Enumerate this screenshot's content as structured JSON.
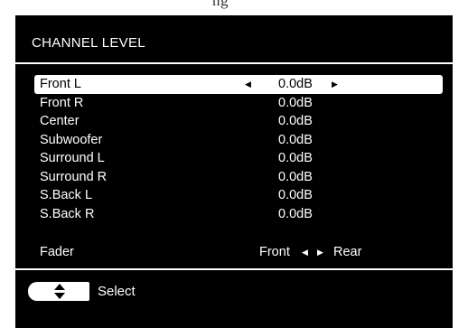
{
  "menu": {
    "title": "CHANNEL LEVEL",
    "channels": [
      {
        "label": "Front L",
        "value": "0.0dB"
      },
      {
        "label": "Front R",
        "value": "0.0dB"
      },
      {
        "label": "Center",
        "value": "0.0dB"
      },
      {
        "label": "Subwoofer",
        "value": "0.0dB"
      },
      {
        "label": "Surround L",
        "value": "0.0dB"
      },
      {
        "label": "Surround R",
        "value": "0.0dB"
      },
      {
        "label": "S.Back L",
        "value": "0.0dB"
      },
      {
        "label": "S.Back R",
        "value": "0.0dB"
      }
    ],
    "selected_index": 0,
    "fader": {
      "label": "Fader",
      "front": "Front",
      "rear": "Rear"
    }
  },
  "hint": {
    "icon": "up-down-arrows-icon",
    "label": "Select"
  },
  "colors": {
    "background": "#000000",
    "text": "#ffffff",
    "highlight": "#ffffff",
    "highlight_text": "#000000"
  }
}
